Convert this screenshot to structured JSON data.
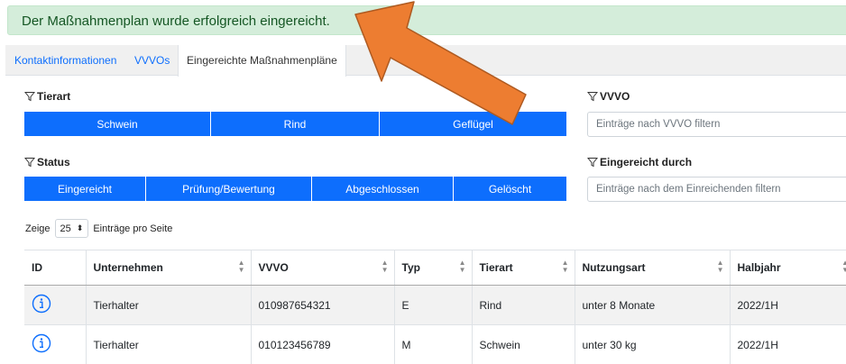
{
  "alert": {
    "message": "Der Maßnahmenplan wurde erfolgreich eingereicht."
  },
  "tabs": [
    {
      "label": "Kontaktinformationen"
    },
    {
      "label": "VVVOs"
    },
    {
      "label": "Eingereichte Maßnahmenpläne"
    }
  ],
  "filters": {
    "tierart": {
      "label": "Tierart",
      "options": [
        "Schwein",
        "Rind",
        "Geflügel"
      ]
    },
    "status": {
      "label": "Status",
      "options": [
        "Eingereicht",
        "Prüfung/Bewertung",
        "Abgeschlossen",
        "Gelöscht"
      ]
    },
    "vvvo": {
      "label": "VVVO",
      "placeholder": "Einträge nach VVVO filtern"
    },
    "eingereicht_durch": {
      "label": "Eingereicht durch",
      "placeholder": "Einträge nach dem Einreichenden filtern"
    }
  },
  "pagination": {
    "show_label": "Zeige",
    "per_page": "25",
    "suffix": "Einträge pro Seite"
  },
  "table": {
    "columns": [
      "ID",
      "Unternehmen",
      "VVVO",
      "Typ",
      "Tierart",
      "Nutzungsart",
      "Halbjahr"
    ],
    "rows": [
      [
        "Tierhalter",
        "010987654321",
        "E",
        "Rind",
        "unter 8 Monate",
        "2022/1H"
      ],
      [
        "Tierhalter",
        "010123456789",
        "M",
        "Schwein",
        "unter 30 kg",
        "2022/1H"
      ]
    ]
  },
  "colors": {
    "primary": "#0d6efd",
    "alert_bg": "#d4edda",
    "alert_text": "#155724",
    "arrow": "#ed7d31"
  },
  "icons": {
    "filter": "funnel-icon",
    "info": "info-circle-icon",
    "sort": "sort-icon",
    "annotation": "orange-arrow"
  }
}
